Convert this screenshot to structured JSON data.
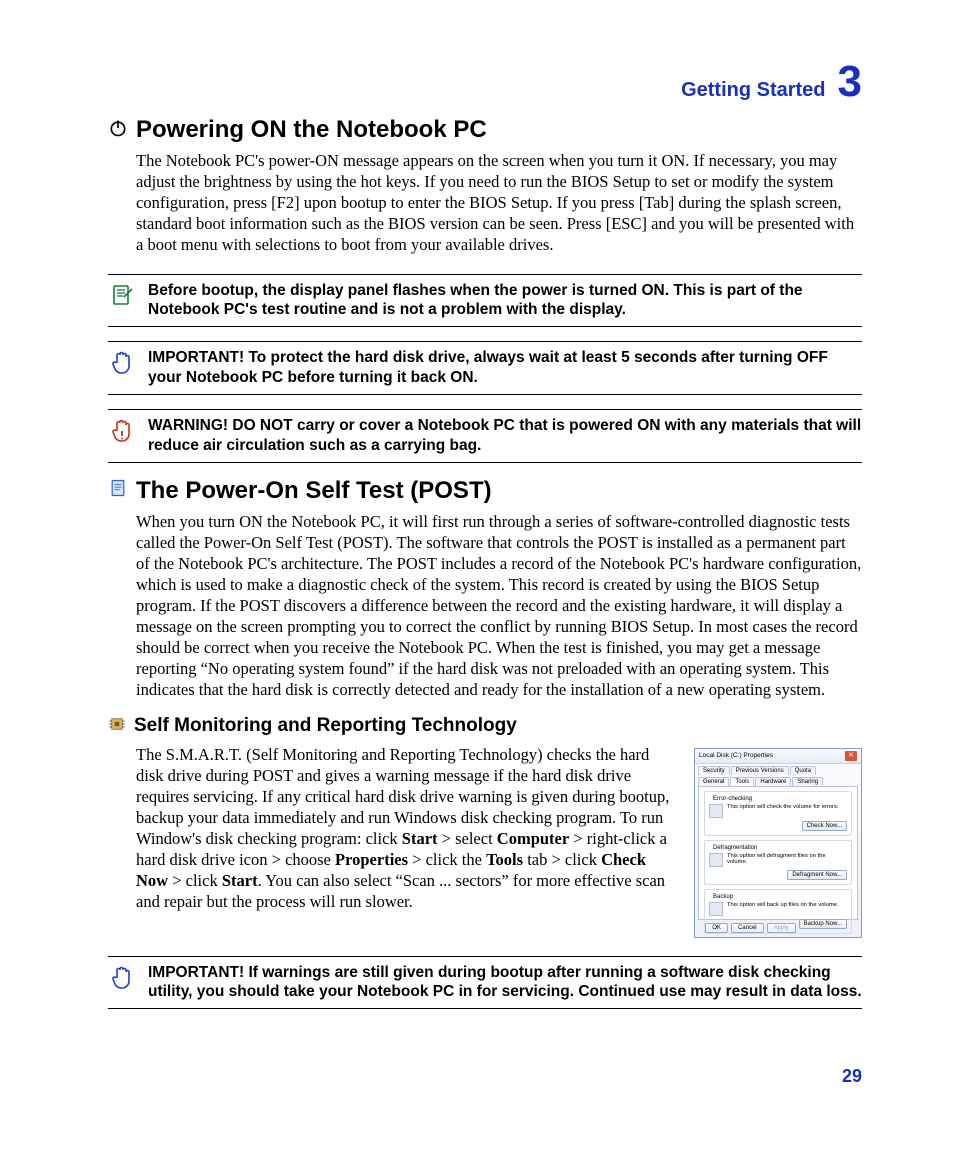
{
  "chapter": {
    "title": "Getting Started",
    "number": "3"
  },
  "page_number": "29",
  "sec1": {
    "heading": "Powering ON the Notebook PC",
    "body": "The Notebook PC's power-ON message appears on the screen when you turn it ON. If necessary, you may adjust the brightness by using the hot keys. If you need to run the BIOS Setup to set or modify the system configuration, press [F2] upon bootup to enter the BIOS Setup. If you press [Tab] during the splash screen, standard boot information such as the BIOS version can be seen. Press [ESC] and you will be presented with a boot menu with selections to boot from your available drives."
  },
  "note1": "Before bootup, the display panel flashes when the power is turned ON. This is part of the Notebook PC's test routine and is not a problem with the display.",
  "note2": "IMPORTANT!  To protect the hard disk drive, always wait at least 5 seconds after turning OFF your Notebook PC before turning it back ON.",
  "note3": "WARNING! DO NOT carry or cover a Notebook PC that is powered ON with any materials that will reduce air circulation such as a carrying bag.",
  "sec2": {
    "heading": "The Power-On Self Test (POST)",
    "body": "When you turn ON the Notebook PC, it will first run through a series of software-controlled diagnostic tests called the Power-On Self Test (POST). The software that controls the POST is installed as a permanent part of the Notebook PC's architecture. The POST includes a record of the Notebook PC's hardware configuration, which is used to make a diagnostic check of the system. This record is created by using the BIOS Setup program. If the POST discovers a difference between the record and the existing hardware, it will display a message on the screen prompting you to correct the conflict by running BIOS Setup. In most cases the record should be correct when you receive the Notebook PC. When the test is finished, you may get a message reporting “No operating system found” if the hard disk was not preloaded with an operating system. This indicates that the hard disk is correctly detected and ready for the installation of a new operating system."
  },
  "sec3": {
    "heading": "Self Monitoring and Reporting Technology",
    "p": {
      "t1": "The S.M.A.R.T. (Self Monitoring and Reporting Technology) checks the hard disk drive during POST and gives a warning message if the hard disk drive requires servicing. If any critical hard disk drive warning is given during bootup, backup your data immediately and run Windows disk checking program. To run Window's disk checking program: click ",
      "b1": "Start",
      "t2": " > select ",
      "b2": "Computer",
      "t3": " > right-click a hard disk drive icon > choose ",
      "b3": "Properties",
      "t4": " > click the ",
      "b4": "Tools",
      "t5": " tab > click ",
      "b5": "Check Now",
      "t6": " > click ",
      "b6": "Start",
      "t7": ". You can also select “Scan ... sectors” for more effective scan and repair but the process will run slower."
    }
  },
  "note4": "IMPORTANT! If warnings are still given during bootup after running a software disk checking utility, you should take your Notebook PC in for servicing. Continued use may result in data loss.",
  "dialog": {
    "title": "Local Disk (C:) Properties",
    "tabs": {
      "security": "Security",
      "prev": "Previous Versions",
      "quota": "Quota",
      "general": "General",
      "tools": "Tools",
      "hardware": "Hardware",
      "sharing": "Sharing"
    },
    "g1": {
      "title": "Error-checking",
      "desc": "This option will check the volume for errors.",
      "btn": "Check Now..."
    },
    "g2": {
      "title": "Defragmentation",
      "desc": "This option will defragment files on the volume.",
      "btn": "Defragment Now..."
    },
    "g3": {
      "title": "Backup",
      "desc": "This option will back up files on the volume.",
      "btn": "Backup Now..."
    },
    "ok": "OK",
    "cancel": "Cancel",
    "apply": "Apply"
  }
}
